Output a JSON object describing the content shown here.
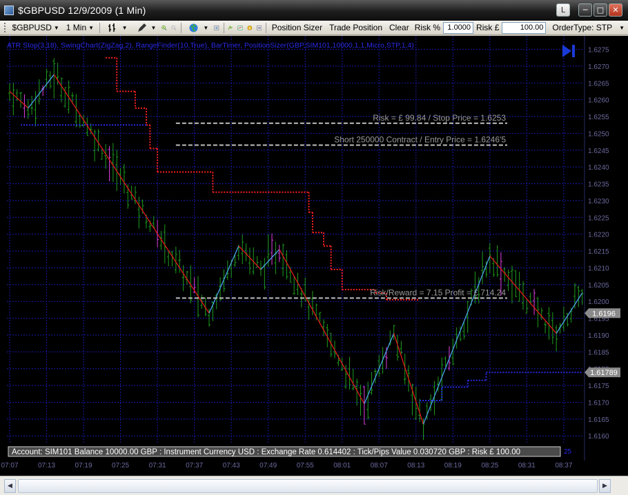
{
  "window": {
    "title": "$GBPUSD  12/9/2009 (1 Min)",
    "btn_l": "L",
    "btn_min": "─",
    "btn_max": "□",
    "btn_close": "✕"
  },
  "toolbar": {
    "instrument": "$GBPUSD",
    "interval": "1 Min",
    "position_sizer": "Position Sizer",
    "trade_position": "Trade Position",
    "clear": "Clear",
    "risk_pct_label": "Risk %",
    "risk_pct_value": "1.0000",
    "risk_gbp_label": "Risk £",
    "risk_gbp_value": "100.00",
    "order_type": "OrderType: STP"
  },
  "colors": {
    "background": "#000000",
    "grid": "#1a1aa8",
    "axis_text": "#6a6aa0",
    "bar_up": "#1e9e1e",
    "bar_down": "#1e9e1e",
    "bar_doji": "#e040e0",
    "zigzag_down": "#e01818",
    "zigzag_up": "#4aa0e8",
    "atr_stop": "#ff2020",
    "range_finder": "#2a2ae8",
    "label_text": "#9a9a9a"
  },
  "chart_data": {
    "type": "candlestick-ohlc",
    "indicator_caption": "ATR Stop(3,18), SwingChart(ZigZag,2), RangeFinder(10,True), BarTimer, PositionSizer(GBP,SIM101,10000,1,1,Micro,STP,1,4)",
    "y_ticks": [
      "1.6275",
      "1.6270",
      "1.6265",
      "1.6260",
      "1.6255",
      "1.6250",
      "1.6245",
      "1.6240",
      "1.6235",
      "1.6230",
      "1.6225",
      "1.6220",
      "1.6215",
      "1.6210",
      "1.6205",
      "1.6200",
      "1.6195",
      "1.6190",
      "1.6185",
      "1.6180",
      "1.6175",
      "1.6170",
      "1.6165",
      "1.6160"
    ],
    "ylim": [
      1.6158,
      1.6279
    ],
    "x_ticks": [
      "07:07",
      "07:13",
      "07:19",
      "07:25",
      "07:31",
      "07:37",
      "07:43",
      "07:49",
      "07:55",
      "08:01",
      "08:07",
      "08:13",
      "08:19",
      "08:25",
      "08:31",
      "08:37"
    ],
    "current_price_label": "1.6196",
    "current_price": 1.61965,
    "stop_marker_label": "1.61789",
    "stop_marker_price": 1.61789,
    "zigzag_points": [
      [
        0,
        1.62625
      ],
      [
        5,
        1.62575
      ],
      [
        12,
        1.62675
      ],
      [
        54,
        1.61965
      ],
      [
        62,
        1.62165
      ],
      [
        68,
        1.62095
      ],
      [
        73,
        1.62155
      ],
      [
        96,
        1.61695
      ],
      [
        104,
        1.61905
      ],
      [
        112,
        1.61635
      ],
      [
        130,
        1.62135
      ],
      [
        148,
        1.61905
      ],
      [
        155,
        1.62025
      ]
    ],
    "atr_stop_segments": [
      [
        26,
        29,
        1.62725
      ],
      [
        29,
        34,
        1.62625
      ],
      [
        34,
        37,
        1.62575
      ],
      [
        37,
        38,
        1.62525
      ],
      [
        38,
        40,
        1.62455
      ],
      [
        40,
        55,
        1.62385
      ],
      [
        55,
        81,
        1.62325
      ],
      [
        81,
        82,
        1.62265
      ],
      [
        82,
        85,
        1.62205
      ],
      [
        85,
        87,
        1.62165
      ],
      [
        87,
        90,
        1.62095
      ],
      [
        90,
        99,
        1.62035
      ],
      [
        99,
        102,
        1.62025
      ],
      [
        102,
        111,
        1.62005
      ]
    ],
    "range_finder_segments": [
      [
        3,
        37,
        1.62525
      ],
      [
        111,
        117,
        1.61705
      ],
      [
        117,
        124,
        1.61745
      ],
      [
        124,
        129,
        1.61765
      ],
      [
        129,
        155,
        1.61789
      ]
    ],
    "annotations": [
      {
        "text": "Risk = £ 99.84 / Stop Price = 1.6253",
        "price": 1.6253
      },
      {
        "text": "Short 250000 Contract / Entry Price = 1.6246'5",
        "price": 1.62465
      },
      {
        "text": "Risk/Reward = 7.15 Profit = £ 714.24",
        "price": 1.6201
      }
    ],
    "status_bar": "Account: SIM101 Balance  10000.00 GBP : Instrument Currency USD : Exchange Rate 0.614402 : Tick/Pips Value 0.030720 GBP : Risk £ 100.00",
    "bar_timer": "25"
  }
}
